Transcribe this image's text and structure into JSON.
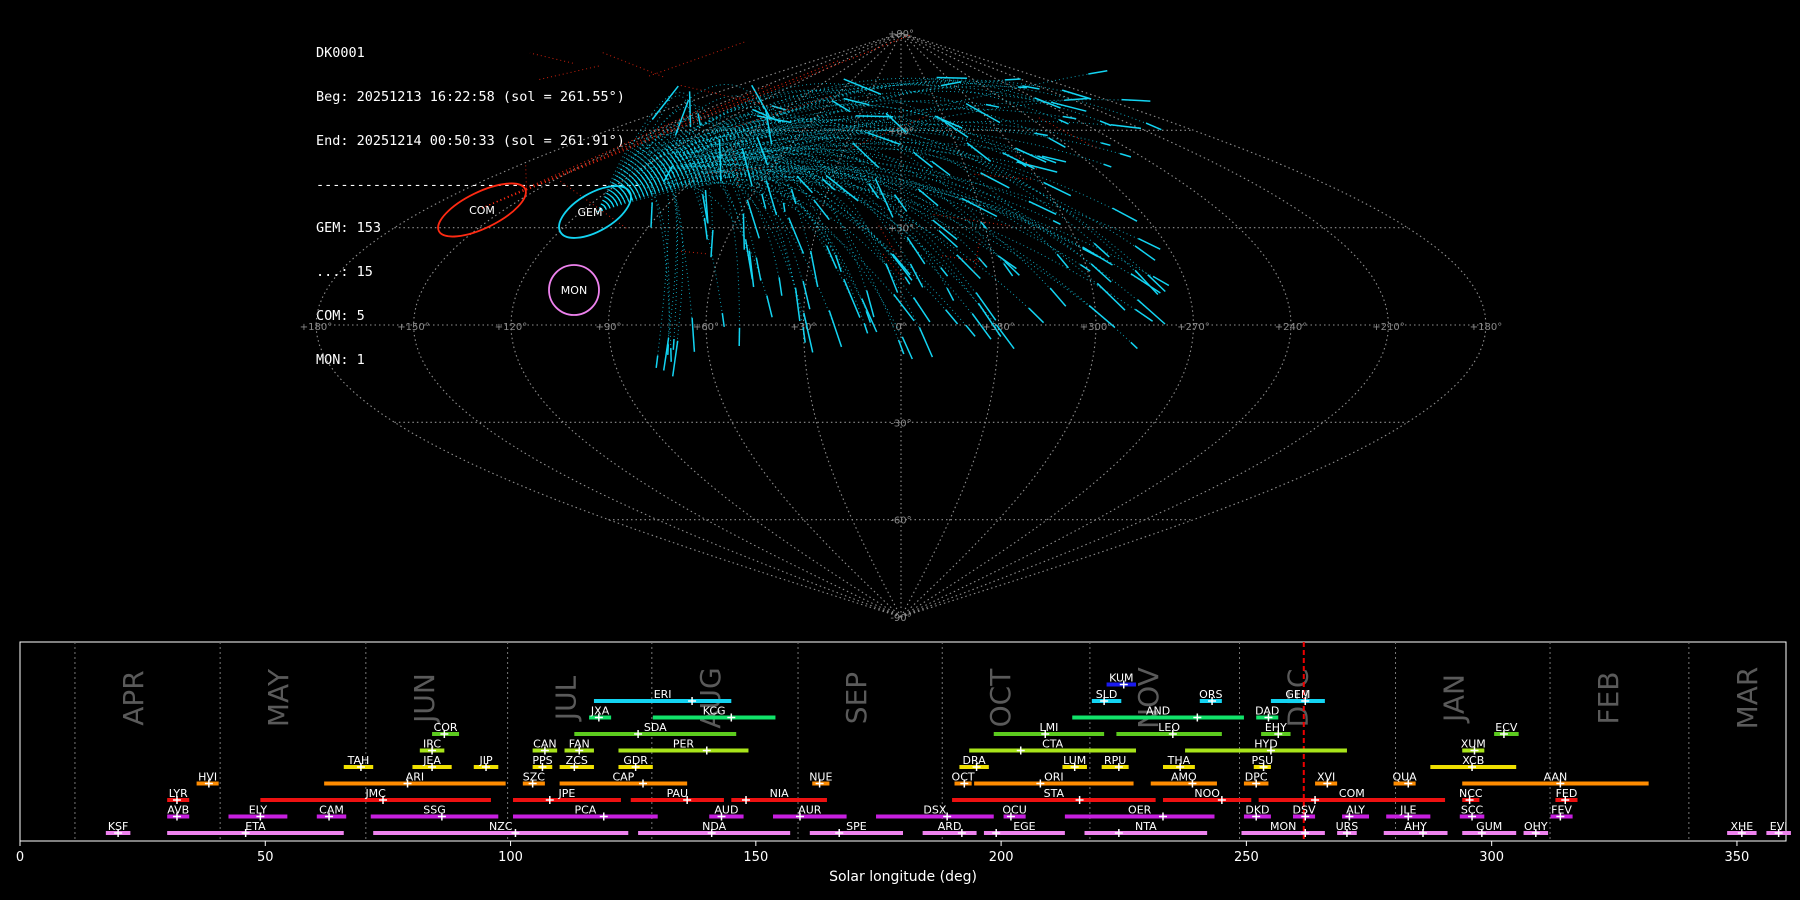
{
  "stats": {
    "station": "DK0001",
    "begin": "Beg: 20251213 16:22:58 (sol = 261.55°)",
    "end": "End: 20251214 00:50:33 (sol = 261.91°)",
    "separator": "----------------------------------------",
    "counts": [
      "GEM: 153",
      "...: 15",
      "COM: 5",
      "MON: 1"
    ]
  },
  "chart_data": [
    {
      "type": "scatter",
      "title": "",
      "projection": "sinusoidal all-sky map",
      "grid": true,
      "grid_lon_labels": [
        "+180°",
        "+150°",
        "+120°",
        "+90°",
        "+60°",
        "+30°",
        "0°",
        "+330°",
        "+300°",
        "+270°",
        "+240°",
        "+210°",
        "+180°"
      ],
      "grid_lat_labels": [
        "+90°",
        "+60°",
        "+30°",
        "-30°",
        "-60°",
        "-90°"
      ],
      "radiants": [
        {
          "name": "COM",
          "color": "#ff2a12"
        },
        {
          "name": "GEM",
          "color": "#13d4f2"
        },
        {
          "name": "MON",
          "color": "#ee82ee"
        }
      ],
      "series": [
        {
          "name": "GEM",
          "color": "#13d4f2",
          "count": 153
        },
        {
          "name": "...",
          "color": "#ff2a12",
          "count": 15
        },
        {
          "name": "COM",
          "color": "#ff2a12",
          "count": 5
        },
        {
          "name": "MON",
          "color": "#ee82ee",
          "count": 1
        }
      ]
    },
    {
      "type": "bar",
      "title": "",
      "xlabel": "Solar longitude (deg)",
      "ylabel": "",
      "xlim": [
        0,
        360
      ],
      "x_ticks": [
        "0",
        "50",
        "100",
        "150",
        "200",
        "250",
        "300",
        "350"
      ],
      "current_sol": 261.7,
      "grid": true,
      "months": [
        {
          "name": "APR",
          "start": 11.2
        },
        {
          "name": "MAY",
          "start": 40.8
        },
        {
          "name": "JUN",
          "start": 70.5
        },
        {
          "name": "JUL",
          "start": 99.4
        },
        {
          "name": "AUG",
          "start": 128.8
        },
        {
          "name": "SEP",
          "start": 158.6
        },
        {
          "name": "OCT",
          "start": 188.0
        },
        {
          "name": "NOV",
          "start": 218.1
        },
        {
          "name": "DEC",
          "start": 248.6
        },
        {
          "name": "JAN",
          "start": 280.4
        },
        {
          "name": "FEB",
          "start": 311.9
        },
        {
          "name": "MAR",
          "start": 340.2
        }
      ],
      "showers": [
        {
          "code": "KSF",
          "row": 0,
          "start": 17.5,
          "end": 22.5,
          "peak": 20.0,
          "color": "#ee82ee"
        },
        {
          "code": "ETA",
          "row": 0,
          "start": 30.0,
          "end": 66.0,
          "peak": 46.0,
          "color": "#ee82ee"
        },
        {
          "code": "NZC",
          "row": 0,
          "start": 72.0,
          "end": 124.0,
          "peak": 101.0,
          "color": "#ee82ee"
        },
        {
          "code": "NDA",
          "row": 0,
          "start": 126.0,
          "end": 157.0,
          "peak": 141.0,
          "color": "#ee82ee"
        },
        {
          "code": "SPE",
          "row": 0,
          "start": 161.0,
          "end": 180.0,
          "peak": 167.0,
          "color": "#ee82ee"
        },
        {
          "code": "ARD",
          "row": 0,
          "start": 184.0,
          "end": 195.0,
          "peak": 192.0,
          "color": "#ee82ee"
        },
        {
          "code": "EGE",
          "row": 0,
          "start": 196.5,
          "end": 213.0,
          "peak": 199.0,
          "color": "#ee82ee"
        },
        {
          "code": "NTA",
          "row": 0,
          "start": 217.0,
          "end": 242.0,
          "peak": 224.0,
          "color": "#ee82ee"
        },
        {
          "code": "MON",
          "row": 0,
          "start": 249.0,
          "end": 266.0,
          "peak": 262.0,
          "color": "#ee82ee"
        },
        {
          "code": "URS",
          "row": 0,
          "start": 268.5,
          "end": 272.5,
          "peak": 270.5,
          "color": "#ee82ee"
        },
        {
          "code": "AHY",
          "row": 0,
          "start": 278.0,
          "end": 291.0,
          "peak": 286.0,
          "color": "#ee82ee"
        },
        {
          "code": "GUM",
          "row": 0,
          "start": 294.0,
          "end": 305.0,
          "peak": 298.0,
          "color": "#ee82ee"
        },
        {
          "code": "OHY",
          "row": 0,
          "start": 306.5,
          "end": 311.5,
          "peak": 309.0,
          "color": "#ee82ee"
        },
        {
          "code": "XHE",
          "row": 0,
          "start": 348.0,
          "end": 354.0,
          "peak": 351.0,
          "color": "#ee82ee"
        },
        {
          "code": "EVI",
          "row": 0,
          "start": 356.0,
          "end": 361.0,
          "peak": 358.5,
          "color": "#ee82ee"
        },
        {
          "code": "AVB",
          "row": 1,
          "start": 30.0,
          "end": 34.5,
          "peak": 32.0,
          "color": "#c71fe0"
        },
        {
          "code": "ELY",
          "row": 1,
          "start": 42.5,
          "end": 54.5,
          "peak": 49.0,
          "color": "#c71fe0"
        },
        {
          "code": "CAM",
          "row": 1,
          "start": 60.5,
          "end": 66.5,
          "peak": 63.0,
          "color": "#c71fe0"
        },
        {
          "code": "SSG",
          "row": 1,
          "start": 71.5,
          "end": 97.5,
          "peak": 86.0,
          "color": "#c71fe0"
        },
        {
          "code": "PCA",
          "row": 1,
          "start": 100.5,
          "end": 130.0,
          "peak": 119.0,
          "color": "#c71fe0"
        },
        {
          "code": "AUD",
          "row": 1,
          "start": 140.5,
          "end": 147.5,
          "peak": 143.0,
          "color": "#c71fe0"
        },
        {
          "code": "AUR",
          "row": 1,
          "start": 153.5,
          "end": 168.5,
          "peak": 159.0,
          "color": "#c71fe0"
        },
        {
          "code": "DSX",
          "row": 1,
          "start": 174.5,
          "end": 198.5,
          "peak": 189.0,
          "color": "#c71fe0"
        },
        {
          "code": "OCU",
          "row": 1,
          "start": 200.5,
          "end": 205.0,
          "peak": 202.0,
          "color": "#c71fe0"
        },
        {
          "code": "OER",
          "row": 1,
          "start": 213.0,
          "end": 243.5,
          "peak": 233.0,
          "color": "#c71fe0"
        },
        {
          "code": "DKD",
          "row": 1,
          "start": 249.5,
          "end": 255.0,
          "peak": 252.0,
          "color": "#c71fe0"
        },
        {
          "code": "DSV",
          "row": 1,
          "start": 259.5,
          "end": 264.0,
          "peak": 262.0,
          "color": "#c71fe0"
        },
        {
          "code": "ALY",
          "row": 1,
          "start": 269.5,
          "end": 275.0,
          "peak": 271.0,
          "color": "#c71fe0"
        },
        {
          "code": "JLE",
          "row": 1,
          "start": 278.5,
          "end": 287.5,
          "peak": 283.0,
          "color": "#c71fe0"
        },
        {
          "code": "SCC",
          "row": 1,
          "start": 293.5,
          "end": 298.5,
          "peak": 296.0,
          "color": "#c71fe0"
        },
        {
          "code": "FEV",
          "row": 1,
          "start": 312.0,
          "end": 316.5,
          "peak": 314.0,
          "color": "#c71fe0"
        },
        {
          "code": "LYR",
          "row": 2,
          "start": 30.0,
          "end": 34.5,
          "peak": 32.0,
          "color": "#ee1111"
        },
        {
          "code": "JMC",
          "row": 2,
          "start": 49.0,
          "end": 96.0,
          "peak": 74.0,
          "color": "#ee1111"
        },
        {
          "code": "JPE",
          "row": 2,
          "start": 100.5,
          "end": 122.5,
          "peak": 108.0,
          "color": "#ee1111"
        },
        {
          "code": "PAU",
          "row": 2,
          "start": 124.5,
          "end": 143.5,
          "peak": 136.0,
          "color": "#ee1111"
        },
        {
          "code": "NIA",
          "row": 2,
          "start": 145.0,
          "end": 164.5,
          "peak": 148.0,
          "color": "#ee1111"
        },
        {
          "code": "STA",
          "row": 2,
          "start": 190.0,
          "end": 231.5,
          "peak": 216.0,
          "color": "#ee1111"
        },
        {
          "code": "NOO",
          "row": 2,
          "start": 233.0,
          "end": 251.0,
          "peak": 245.0,
          "color": "#ee1111"
        },
        {
          "code": "COM",
          "row": 2,
          "start": 252.5,
          "end": 290.5,
          "peak": 264.0,
          "color": "#ee1111"
        },
        {
          "code": "NCC",
          "row": 2,
          "start": 294.0,
          "end": 297.5,
          "peak": 295.5,
          "color": "#ee1111"
        },
        {
          "code": "FED",
          "row": 2,
          "start": 313.0,
          "end": 317.5,
          "peak": 315.0,
          "color": "#ee1111"
        },
        {
          "code": "HVI",
          "row": 3,
          "start": 36.0,
          "end": 40.5,
          "peak": 38.5,
          "color": "#ff8c00"
        },
        {
          "code": "ARI",
          "row": 3,
          "start": 62.0,
          "end": 99.0,
          "peak": 79.0,
          "color": "#ff8c00"
        },
        {
          "code": "SZC",
          "row": 3,
          "start": 102.5,
          "end": 107.0,
          "peak": 104.5,
          "color": "#ff8c00"
        },
        {
          "code": "CAP",
          "row": 3,
          "start": 110.0,
          "end": 136.0,
          "peak": 127.0,
          "color": "#ff8c00"
        },
        {
          "code": "NUE",
          "row": 3,
          "start": 161.5,
          "end": 165.0,
          "peak": 163.0,
          "color": "#ff8c00"
        },
        {
          "code": "OCT",
          "row": 3,
          "start": 190.5,
          "end": 194.0,
          "peak": 192.5,
          "color": "#ff8c00"
        },
        {
          "code": "ORI",
          "row": 3,
          "start": 194.5,
          "end": 227.0,
          "peak": 208.0,
          "color": "#ff8c00"
        },
        {
          "code": "AMO",
          "row": 3,
          "start": 230.5,
          "end": 244.0,
          "peak": 239.0,
          "color": "#ff8c00"
        },
        {
          "code": "DPC",
          "row": 3,
          "start": 249.5,
          "end": 254.5,
          "peak": 252.0,
          "color": "#ff8c00"
        },
        {
          "code": "XVI",
          "row": 3,
          "start": 264.0,
          "end": 268.5,
          "peak": 266.5,
          "color": "#ff8c00"
        },
        {
          "code": "QUA",
          "row": 3,
          "start": 280.0,
          "end": 284.5,
          "peak": 283.0,
          "color": "#ff8c00"
        },
        {
          "code": "AAN",
          "row": 3,
          "start": 294.0,
          "end": 332.0,
          "peak": 314.0,
          "color": "#ff8c00"
        },
        {
          "code": "TAH",
          "row": 4,
          "start": 66.0,
          "end": 72.0,
          "peak": 69.5,
          "color": "#f0e000"
        },
        {
          "code": "JEA",
          "row": 4,
          "start": 80.0,
          "end": 88.0,
          "peak": 84.0,
          "color": "#f0e000"
        },
        {
          "code": "JIP",
          "row": 4,
          "start": 92.5,
          "end": 97.5,
          "peak": 95.0,
          "color": "#f0e000"
        },
        {
          "code": "PPS",
          "row": 4,
          "start": 104.5,
          "end": 108.5,
          "peak": 106.5,
          "color": "#f0e000"
        },
        {
          "code": "ZCS",
          "row": 4,
          "start": 110.0,
          "end": 117.0,
          "peak": 113.0,
          "color": "#f0e000"
        },
        {
          "code": "GDR",
          "row": 4,
          "start": 122.0,
          "end": 129.0,
          "peak": 125.5,
          "color": "#f0e000"
        },
        {
          "code": "DRA",
          "row": 4,
          "start": 191.5,
          "end": 197.5,
          "peak": 195.0,
          "color": "#f0e000"
        },
        {
          "code": "LUM",
          "row": 4,
          "start": 212.5,
          "end": 217.5,
          "peak": 215.0,
          "color": "#f0e000"
        },
        {
          "code": "RPU",
          "row": 4,
          "start": 220.5,
          "end": 226.0,
          "peak": 224.0,
          "color": "#f0e000"
        },
        {
          "code": "THA",
          "row": 4,
          "start": 233.0,
          "end": 239.5,
          "peak": 236.5,
          "color": "#f0e000"
        },
        {
          "code": "PSU",
          "row": 4,
          "start": 251.5,
          "end": 255.0,
          "peak": 253.5,
          "color": "#f0e000"
        },
        {
          "code": "XCB",
          "row": 4,
          "start": 287.5,
          "end": 305.0,
          "peak": 296.0,
          "color": "#f0e000"
        },
        {
          "code": "IRC",
          "row": 5,
          "start": 81.5,
          "end": 86.5,
          "peak": 84.0,
          "color": "#a8e41a"
        },
        {
          "code": "CAN",
          "row": 5,
          "start": 104.5,
          "end": 109.5,
          "peak": 107.0,
          "color": "#a8e41a"
        },
        {
          "code": "FAN",
          "row": 5,
          "start": 111.0,
          "end": 117.0,
          "peak": 114.0,
          "color": "#a8e41a"
        },
        {
          "code": "PER",
          "row": 5,
          "start": 122.0,
          "end": 148.5,
          "peak": 140.0,
          "color": "#a8e41a"
        },
        {
          "code": "CTA",
          "row": 5,
          "start": 193.5,
          "end": 227.5,
          "peak": 204.0,
          "color": "#a8e41a"
        },
        {
          "code": "HYD",
          "row": 5,
          "start": 237.5,
          "end": 270.5,
          "peak": 255.0,
          "color": "#a8e41a"
        },
        {
          "code": "XUM",
          "row": 5,
          "start": 294.0,
          "end": 298.5,
          "peak": 296.5,
          "color": "#a8e41a"
        },
        {
          "code": "COR",
          "row": 6,
          "start": 84.0,
          "end": 89.5,
          "peak": 86.5,
          "color": "#5ccb1e"
        },
        {
          "code": "SDA",
          "row": 6,
          "start": 113.0,
          "end": 146.0,
          "peak": 126.0,
          "color": "#5ccb1e"
        },
        {
          "code": "LMI",
          "row": 6,
          "start": 198.5,
          "end": 221.0,
          "peak": 209.0,
          "color": "#5ccb1e"
        },
        {
          "code": "LEO",
          "row": 6,
          "start": 223.5,
          "end": 245.0,
          "peak": 235.0,
          "color": "#5ccb1e"
        },
        {
          "code": "EHY",
          "row": 6,
          "start": 253.0,
          "end": 259.0,
          "peak": 256.5,
          "color": "#5ccb1e"
        },
        {
          "code": "ECV",
          "row": 6,
          "start": 300.5,
          "end": 305.5,
          "peak": 302.5,
          "color": "#5ccb1e"
        },
        {
          "code": "JXA",
          "row": 7,
          "start": 116.0,
          "end": 120.5,
          "peak": 118.0,
          "color": "#11e36a"
        },
        {
          "code": "KCG",
          "row": 7,
          "start": 129.0,
          "end": 154.0,
          "peak": 145.0,
          "color": "#11e36a"
        },
        {
          "code": "AND",
          "row": 7,
          "start": 214.5,
          "end": 249.5,
          "peak": 240.0,
          "color": "#11e36a"
        },
        {
          "code": "DAD",
          "row": 7,
          "start": 252.0,
          "end": 256.5,
          "peak": 254.5,
          "color": "#11e36a"
        },
        {
          "code": "ERI",
          "row": 8,
          "start": 117.0,
          "end": 145.0,
          "peak": 137.0,
          "color": "#13d4f2"
        },
        {
          "code": "SLD",
          "row": 8,
          "start": 218.5,
          "end": 224.5,
          "peak": 221.0,
          "color": "#13d4f2"
        },
        {
          "code": "ORS",
          "row": 8,
          "start": 240.5,
          "end": 245.0,
          "peak": 243.0,
          "color": "#13d4f2"
        },
        {
          "code": "GEM",
          "row": 8,
          "start": 255.0,
          "end": 266.0,
          "peak": 262.0,
          "color": "#13d4f2"
        },
        {
          "code": "KUM",
          "row": 9,
          "start": 221.5,
          "end": 227.5,
          "peak": 225.0,
          "color": "#1a1aee"
        }
      ]
    }
  ]
}
